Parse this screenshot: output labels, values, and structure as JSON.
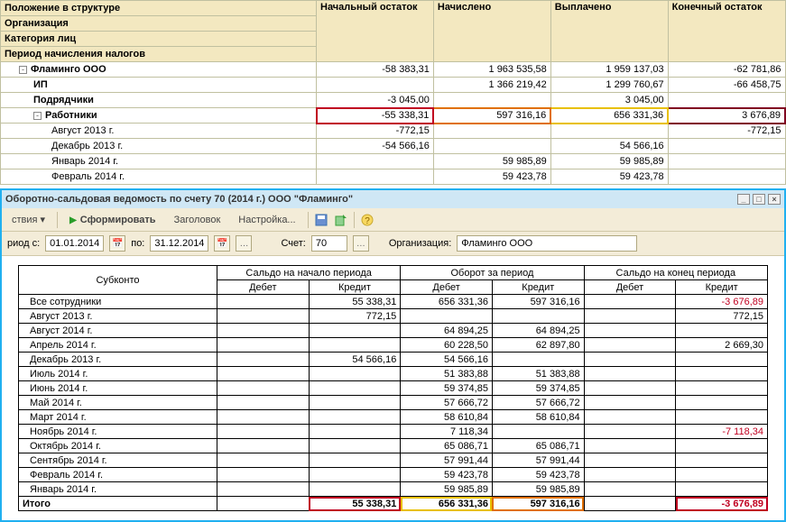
{
  "top": {
    "headers": {
      "structure": "Положение в структуре",
      "start": "Начальный остаток",
      "accrued": "Начислено",
      "paid": "Выплачено",
      "end": "Конечный остаток",
      "org": "Организация",
      "cat": "Категория лиц",
      "period": "Период начисления налогов"
    },
    "rows": [
      {
        "label": "Фламинго ООО",
        "indent": 1,
        "toggle": true,
        "start": "-58 383,31",
        "acc": "1 963 535,58",
        "paid": "1 959 137,03",
        "end": "-62 781,86"
      },
      {
        "label": "ИП",
        "indent": 2,
        "toggle": false,
        "start": "",
        "acc": "1 366 219,42",
        "paid": "1 299 760,67",
        "end": "-66 458,75"
      },
      {
        "label": "Подрядчики",
        "indent": 2,
        "toggle": false,
        "start": "-3 045,00",
        "acc": "",
        "paid": "3 045,00",
        "end": ""
      },
      {
        "label": "Работники",
        "indent": 2,
        "toggle": true,
        "start": "-55 338,31",
        "acc": "597 316,16",
        "paid": "656 331,36",
        "end": "3 676,89",
        "hl": true
      },
      {
        "label": "Август 2013 г.",
        "indent": 3,
        "toggle": false,
        "start": "-772,15",
        "acc": "",
        "paid": "",
        "end": "-772,15"
      },
      {
        "label": "Декабрь 2013 г.",
        "indent": 3,
        "toggle": false,
        "start": "-54 566,16",
        "acc": "",
        "paid": "54 566,16",
        "end": ""
      },
      {
        "label": "Январь 2014 г.",
        "indent": 3,
        "toggle": false,
        "start": "",
        "acc": "59 985,89",
        "paid": "59 985,89",
        "end": ""
      },
      {
        "label": "Февраль 2014 г.",
        "indent": 3,
        "toggle": false,
        "start": "",
        "acc": "59 423,78",
        "paid": "59 423,78",
        "end": ""
      }
    ]
  },
  "window": {
    "title": "Оборотно-сальдовая ведомость по счету 70 (2014 г.) ООО \"Фламинго\"",
    "actions_label": "ствия",
    "form_btn": "Сформировать",
    "header_btn": "Заголовок",
    "settings_btn": "Настройка...",
    "period_from_label": "риод с:",
    "date_from": "01.01.2014",
    "to_label": "по:",
    "date_to": "31.12.2014",
    "account_label": "Счет:",
    "account": "70",
    "org_label": "Организация:",
    "org": "Фламинго ООО"
  },
  "report": {
    "headers": {
      "subconto": "Субконто",
      "saldo_start": "Сальдо на начало периода",
      "turnover": "Оборот за период",
      "saldo_end": "Сальдо на конец периода",
      "debit": "Дебет",
      "credit": "Кредит"
    },
    "rows": [
      {
        "label": "Все сотрудники",
        "sd": "",
        "sc": "55 338,31",
        "td": "656 331,36",
        "tc": "597 316,16",
        "ed": "",
        "ec": "-3 676,89",
        "ec_neg": true
      },
      {
        "label": "Август 2013 г.",
        "sd": "",
        "sc": "772,15",
        "td": "",
        "tc": "",
        "ed": "",
        "ec": "772,15"
      },
      {
        "label": "Август 2014 г.",
        "sd": "",
        "sc": "",
        "td": "64 894,25",
        "tc": "64 894,25",
        "ed": "",
        "ec": ""
      },
      {
        "label": "Апрель 2014 г.",
        "sd": "",
        "sc": "",
        "td": "60 228,50",
        "tc": "62 897,80",
        "ed": "",
        "ec": "2 669,30"
      },
      {
        "label": "Декабрь 2013 г.",
        "sd": "",
        "sc": "54 566,16",
        "td": "54 566,16",
        "tc": "",
        "ed": "",
        "ec": ""
      },
      {
        "label": "Июль 2014 г.",
        "sd": "",
        "sc": "",
        "td": "51 383,88",
        "tc": "51 383,88",
        "ed": "",
        "ec": ""
      },
      {
        "label": "Июнь 2014 г.",
        "sd": "",
        "sc": "",
        "td": "59 374,85",
        "tc": "59 374,85",
        "ed": "",
        "ec": ""
      },
      {
        "label": "Май 2014 г.",
        "sd": "",
        "sc": "",
        "td": "57 666,72",
        "tc": "57 666,72",
        "ed": "",
        "ec": ""
      },
      {
        "label": "Март 2014 г.",
        "sd": "",
        "sc": "",
        "td": "58 610,84",
        "tc": "58 610,84",
        "ed": "",
        "ec": ""
      },
      {
        "label": "Ноябрь 2014 г.",
        "sd": "",
        "sc": "",
        "td": "7 118,34",
        "tc": "",
        "ed": "",
        "ec": "-7 118,34",
        "ec_neg": true
      },
      {
        "label": "Октябрь 2014 г.",
        "sd": "",
        "sc": "",
        "td": "65 086,71",
        "tc": "65 086,71",
        "ed": "",
        "ec": ""
      },
      {
        "label": "Сентябрь 2014 г.",
        "sd": "",
        "sc": "",
        "td": "57 991,44",
        "tc": "57 991,44",
        "ed": "",
        "ec": ""
      },
      {
        "label": "Февраль 2014 г.",
        "sd": "",
        "sc": "",
        "td": "59 423,78",
        "tc": "59 423,78",
        "ed": "",
        "ec": ""
      },
      {
        "label": "Январь 2014 г.",
        "sd": "",
        "sc": "",
        "td": "59 985,89",
        "tc": "59 985,89",
        "ed": "",
        "ec": ""
      }
    ],
    "total": {
      "label": "Итого",
      "sd": "",
      "sc": "55 338,31",
      "td": "656 331,36",
      "tc": "597 316,16",
      "ed": "",
      "ec": "-3 676,89"
    }
  }
}
